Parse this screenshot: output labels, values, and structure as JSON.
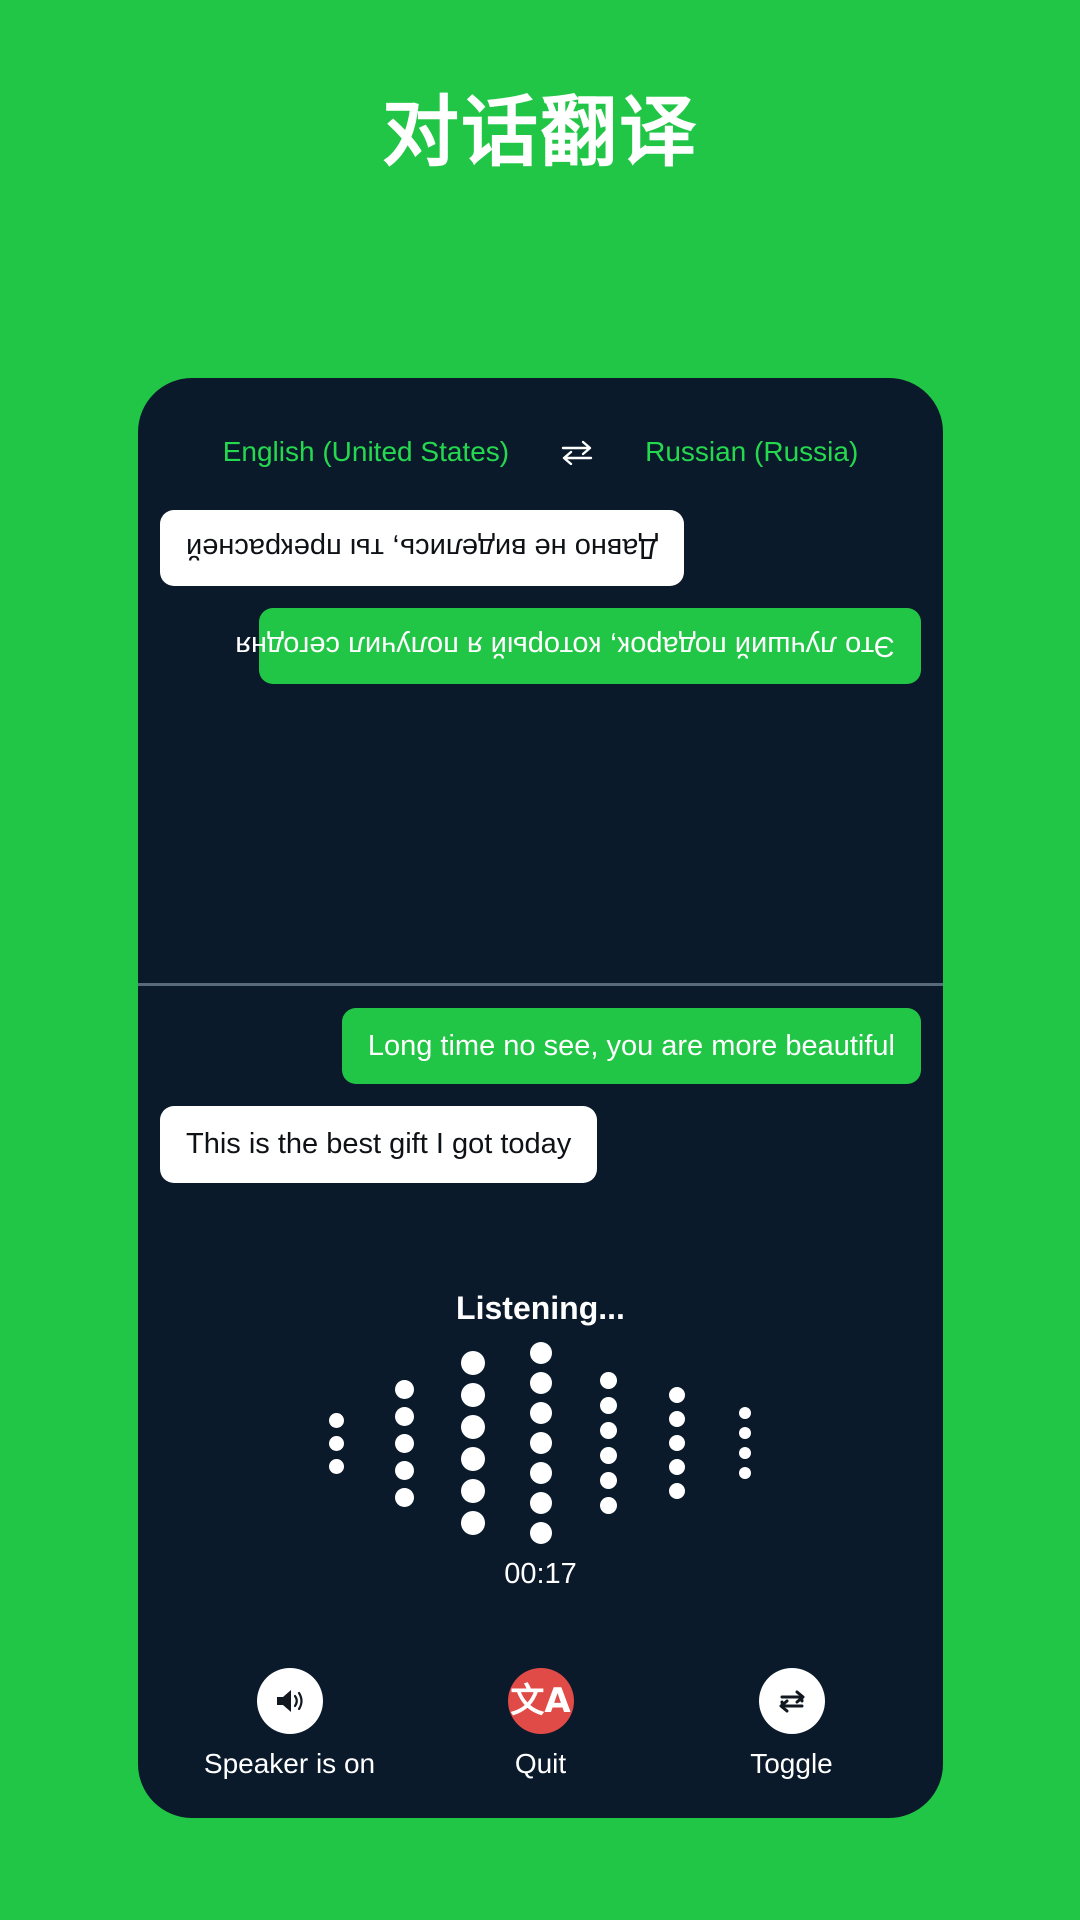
{
  "page": {
    "title": "对话翻译",
    "background_color": "#22c646",
    "panel_color": "#0b1a2b"
  },
  "language_bar": {
    "source_language": "English (United States)",
    "target_language": "Russian (Russia)",
    "swap_icon": "swap-horizontal-icon",
    "text_color": "#25d94f"
  },
  "remote_pane": {
    "description": "Upside-down view for the person across the table",
    "messages": [
      {
        "text": "Это лучший подарок, который я получил сегодня",
        "style": "green",
        "align": "left"
      },
      {
        "text": "Давно не виделись, ты прекрасней",
        "style": "white",
        "align": "right"
      }
    ]
  },
  "local_pane": {
    "messages": [
      {
        "text": "Long time no see, you are more beautiful",
        "style": "green",
        "align": "right"
      },
      {
        "text": "This is the best gift I got today",
        "style": "white",
        "align": "left"
      }
    ]
  },
  "listening": {
    "status_text": "Listening...",
    "timer": "00:17",
    "waveform": {
      "columns": [
        {
          "dots": 3,
          "size": 15
        },
        {
          "dots": 5,
          "size": 19
        },
        {
          "dots": 6,
          "size": 24
        },
        {
          "dots": 7,
          "size": 22
        },
        {
          "dots": 6,
          "size": 17
        },
        {
          "dots": 5,
          "size": 16
        },
        {
          "dots": 4,
          "size": 12
        }
      ],
      "dot_color": "#ffffff"
    }
  },
  "controls": [
    {
      "label": "Speaker is on",
      "icon": "speaker-on-icon",
      "circle_color": "#ffffff",
      "icon_color": "#111820"
    },
    {
      "label": "Quit",
      "icon": "translate-icon",
      "circle_color": "#e04b47",
      "icon_color": "#ffffff",
      "glyph": "文A"
    },
    {
      "label": "Toggle",
      "icon": "toggle-swap-icon",
      "circle_color": "#ffffff",
      "icon_color": "#111820"
    }
  ]
}
